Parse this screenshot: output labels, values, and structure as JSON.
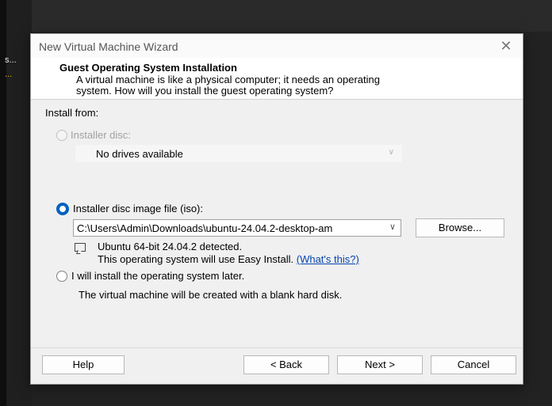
{
  "background": {
    "items": [
      "s...",
      "..."
    ]
  },
  "dialog": {
    "title": "New Virtual Machine Wizard",
    "close_icon": "✕",
    "header_title": "Guest Operating System Installation",
    "header_desc_line1": "A virtual machine is like a physical computer; it needs an operating",
    "header_desc_line2": "system. How will you install the guest operating system?",
    "install_from_label": "Install from:",
    "options": {
      "installer_disc": {
        "label": "Installer disc:",
        "selected": false,
        "enabled": false
      },
      "iso": {
        "label": "Installer disc image file (iso):",
        "selected": true
      },
      "later": {
        "label": "I will install the operating system later.",
        "selected": false
      }
    },
    "drives_select": "No drives available",
    "iso_path": "C:\\Users\\Admin\\Downloads\\ubuntu-24.04.2-desktop-am",
    "browse_label": "Browse...",
    "detected_text": "Ubuntu 64-bit 24.04.2 detected.",
    "easy_install_text": "This operating system will use Easy Install.",
    "whats_this_link": "(What's this?)",
    "blank_disk_text": "The virtual machine will be created with a blank hard disk.",
    "buttons": {
      "help": "Help",
      "back": "< Back",
      "next": "Next >",
      "cancel": "Cancel"
    }
  },
  "colors": {
    "accent": "#0060c0",
    "link": "#0645ad"
  }
}
